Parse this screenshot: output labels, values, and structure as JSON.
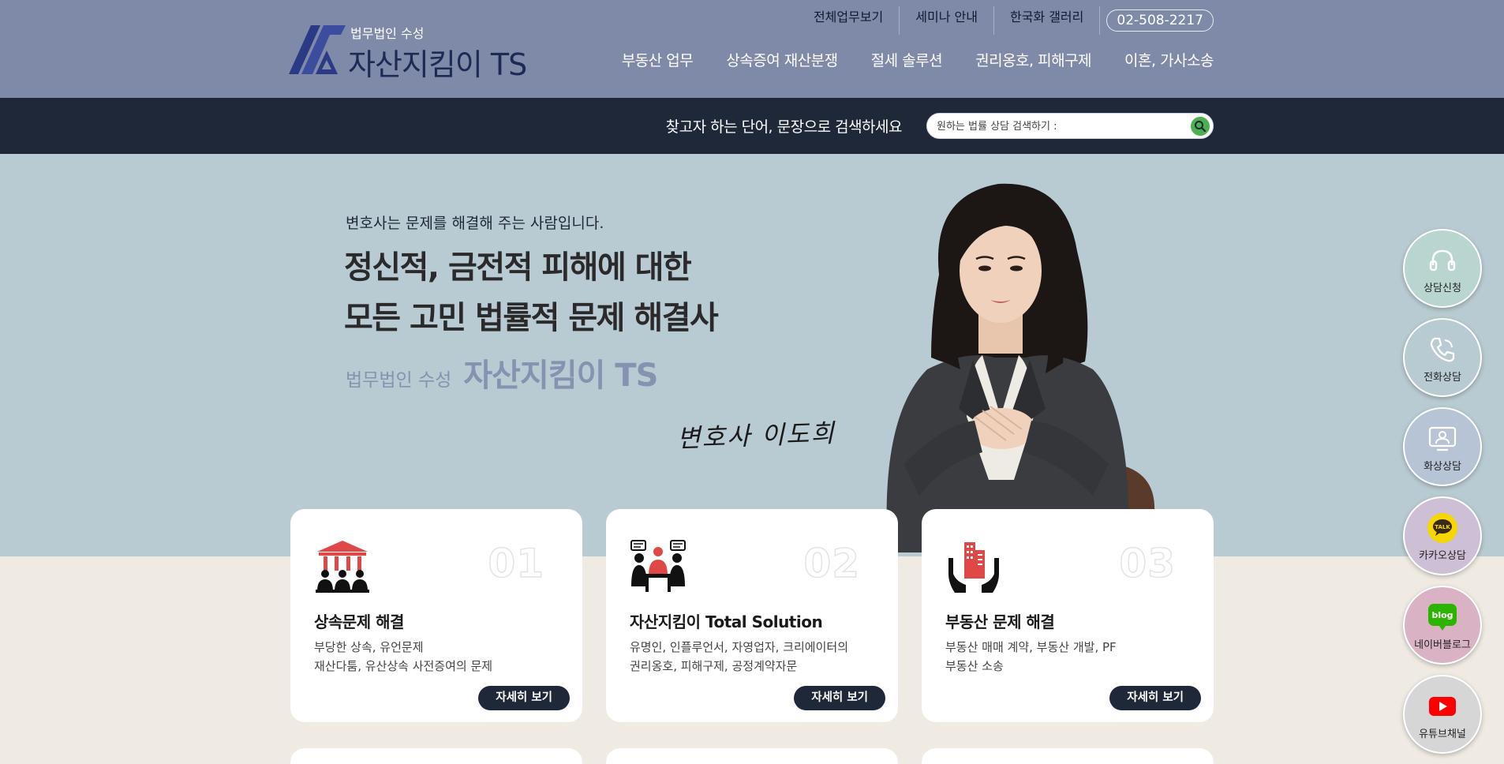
{
  "header": {
    "logo": {
      "sub": "법무법인 수성",
      "main": "자산지킴이 TS"
    },
    "top_links": [
      "전체업무보기",
      "세미나 안내",
      "한국화 갤러리"
    ],
    "phone": "02-508-2217",
    "nav": [
      "부동산 업무",
      "상속증여 재산분쟁",
      "절세 솔루션",
      "권리옹호, 피해구제",
      "이혼, 가사소송"
    ]
  },
  "search": {
    "caption": "찾고자 하는 단어, 문장으로 검색하세요",
    "placeholder": "원하는 법률 상담 검색하기 :",
    "button_icon": "search-icon"
  },
  "hero": {
    "kicker": "변호사는 문제를 해결해 주는 사람입니다.",
    "headline_line1": "정신적, 금전적 피해에 대한",
    "headline_line2": "모든 고민 법률적 문제 해결사",
    "firm_sub": "법무법인 수성",
    "firm_main": "자산지킴이 TS",
    "signature": "변호사 이도희"
  },
  "cards": [
    {
      "number": "01",
      "icon": "courthouse-people-icon",
      "title": "상속문제 해결",
      "desc_line1": "부당한 상속, 유언문제",
      "desc_line2": "재산다툼, 유산상속 사전증여의 문제",
      "button": "자세히 보기"
    },
    {
      "number": "02",
      "icon": "meeting-discussion-icon",
      "title": "자산지킴이 Total Solution",
      "desc_line1": "유명인, 인플루언서, 자영업자, 크리에이터의",
      "desc_line2": "권리옹호, 피해구제, 공정계약자문",
      "button": "자세히 보기"
    },
    {
      "number": "03",
      "icon": "building-hands-icon",
      "title": "부동산 문제 해결",
      "desc_line1": "부동산 매매 계약, 부동산 개발, PF",
      "desc_line2": "부동산 소송",
      "button": "자세히 보기"
    }
  ],
  "side_buttons": [
    {
      "label": "상담신청",
      "icon": "headset-icon",
      "color": "#b8d6cf"
    },
    {
      "label": "전화상담",
      "icon": "phone-icon",
      "color": "#b9cbd2"
    },
    {
      "label": "화상상담",
      "icon": "video-call-icon",
      "color": "#b6c4d6"
    },
    {
      "label": "카카오상담",
      "icon": "kakao-talk-icon",
      "color": "#cdbfd6"
    },
    {
      "label": "네이버블로그",
      "icon": "naver-blog-icon",
      "color": "#d9b3c3"
    },
    {
      "label": "유튜브채널",
      "icon": "youtube-icon",
      "color": "#d6d6d6"
    }
  ],
  "colors": {
    "header_bg": "#7f8aa9",
    "searchbar_bg": "#1f2838",
    "hero_bg": "#b9cbd2",
    "page_bg": "#efebe3",
    "accent_red": "#e04848",
    "logo_navy": "#2b3a85"
  }
}
